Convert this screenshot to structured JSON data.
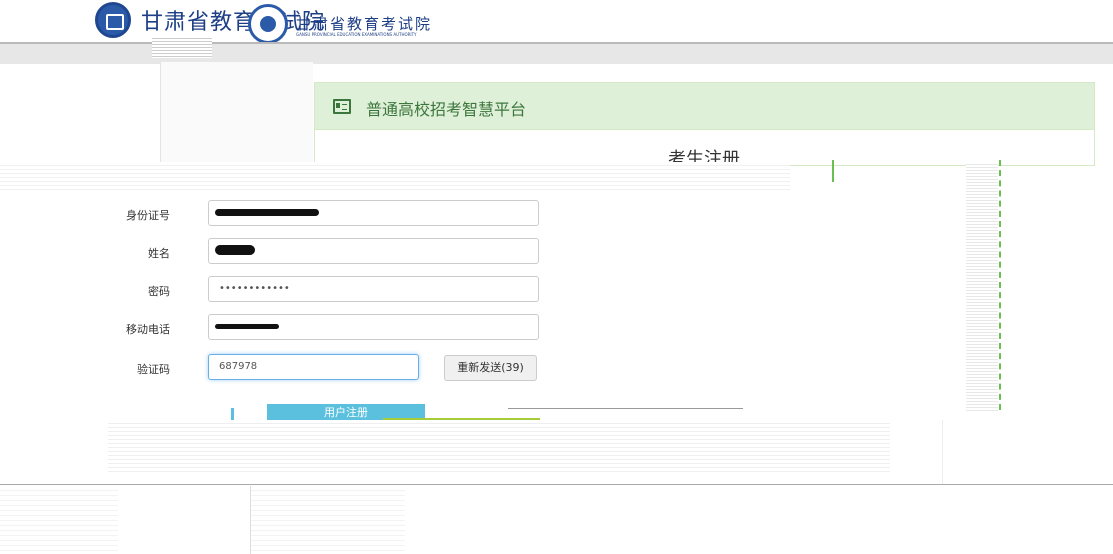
{
  "header": {
    "site_title": "甘肃省教育考试院",
    "wordmark_cn": "甘肃省教育考试院",
    "wordmark_en": "GANSU PROVINCIAL EDUCATION EXAMINATIONS AUTHORITY"
  },
  "panel": {
    "title": "普通高校招考智慧平台",
    "subtitle": "考生注册"
  },
  "form": {
    "fields": [
      {
        "label": "身份证号",
        "value": ""
      },
      {
        "label": "姓名",
        "value": ""
      },
      {
        "label": "密码",
        "value": "••••••••••••"
      },
      {
        "label": "移动电话",
        "value": ""
      },
      {
        "label": "验证码",
        "value": "687978"
      }
    ],
    "resend_label": "重新发送(39)"
  },
  "buttons": {
    "register": "用户注册",
    "back": ""
  },
  "colors": {
    "panel_header_bg": "#dff0d8",
    "panel_title": "#3c763d",
    "register_button": "#5bc0de",
    "back_button": "#a5cd39",
    "focus_border": "#66afe9"
  }
}
